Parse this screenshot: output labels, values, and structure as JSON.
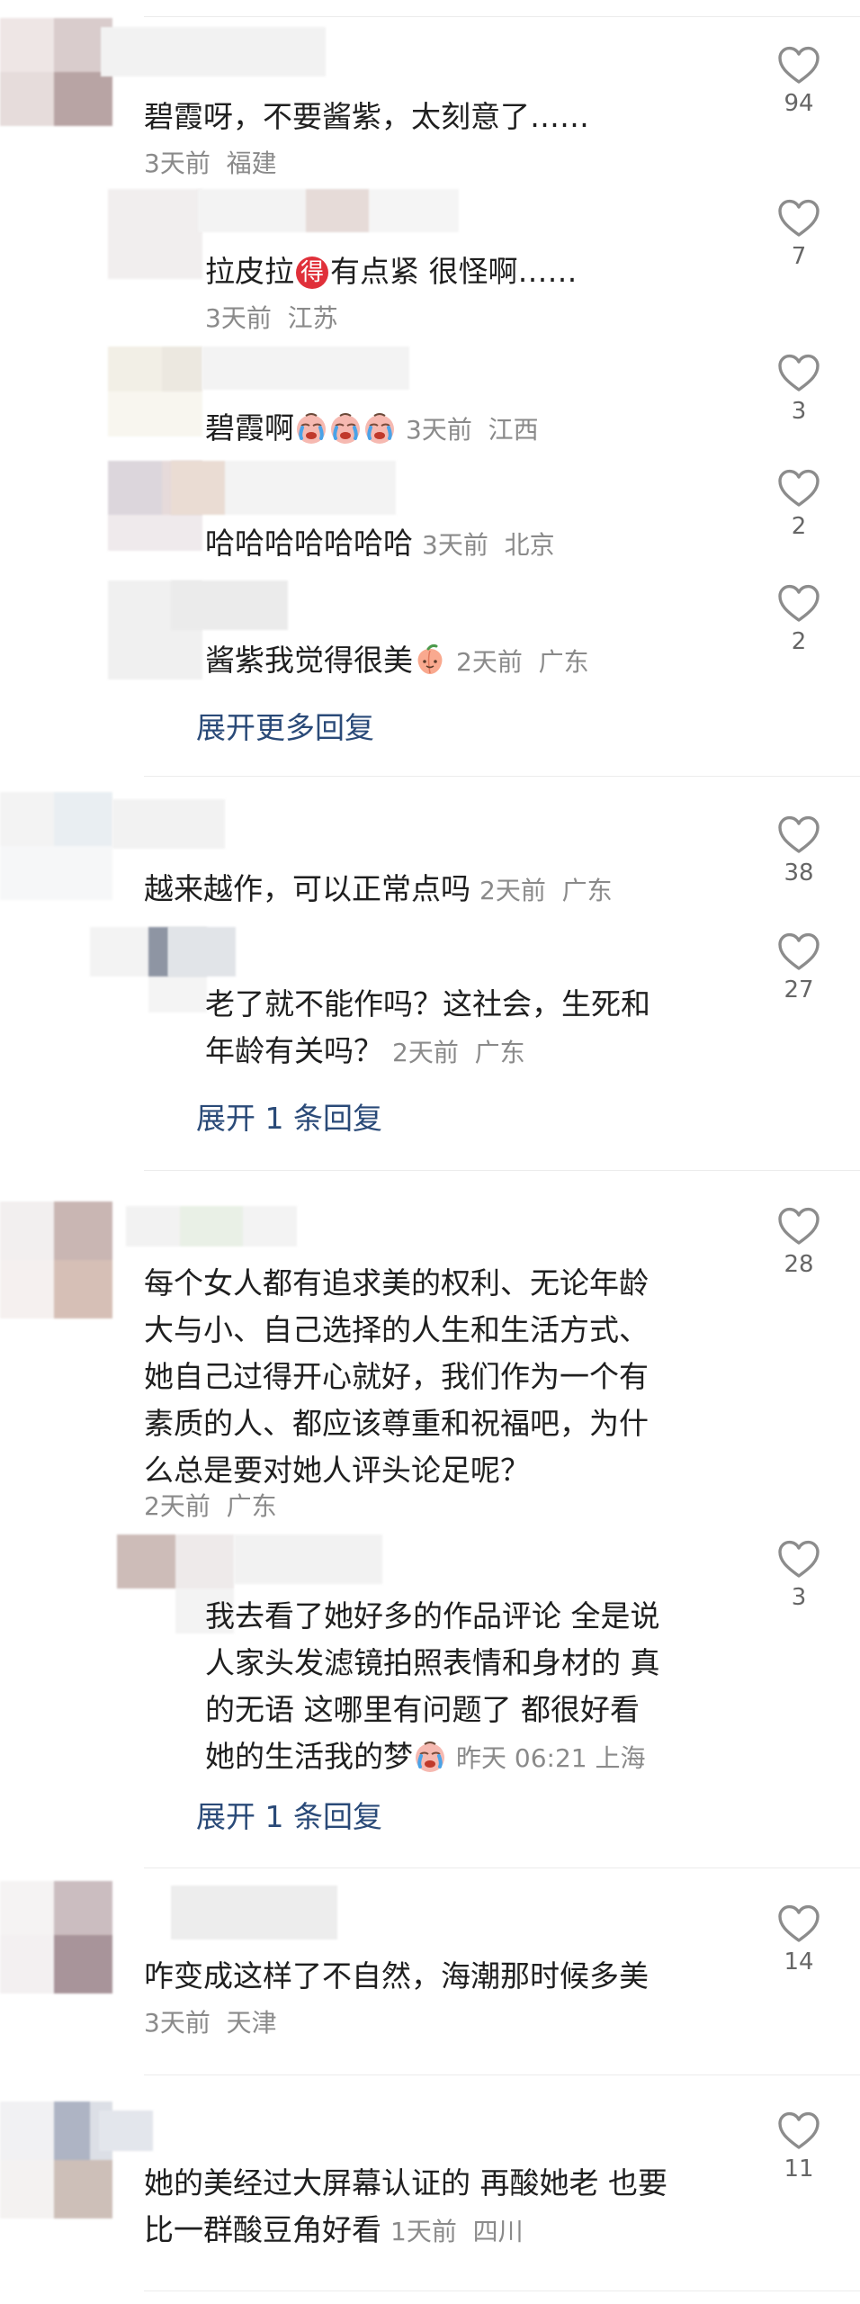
{
  "comments": [
    {
      "text": "碧霞呀，不要酱紫，太刻意了……",
      "meta": "3天前  福建",
      "likes": "94",
      "replies": [
        {
          "text_a": "拉皮拉",
          "badge": "得",
          "text_b": "有点紧 很怪啊……",
          "meta": "3天前  江苏",
          "likes": "7"
        },
        {
          "text": "碧霞啊",
          "meta": "3天前  江西",
          "likes": "3"
        },
        {
          "text": "哈哈哈哈哈哈哈",
          "meta": "3天前  北京",
          "likes": "2"
        },
        {
          "text": "酱紫我觉得很美",
          "meta": "2天前  广东",
          "likes": "2"
        }
      ],
      "expand": "展开更多回复"
    },
    {
      "text": "越来越作，可以正常点吗",
      "meta": "2天前  广东",
      "likes": "38",
      "replies": [
        {
          "line1": "老了就不能作吗？这社会，生死和",
          "line2": "年龄有关吗？",
          "meta": "2天前  广东",
          "likes": "27"
        }
      ],
      "expand": "展开 1 条回复"
    },
    {
      "lines": [
        "每个女人都有追求美的权利、无论年龄",
        "大与小、自己选择的人生和生活方式、",
        "她自己过得开心就好，我们作为一个有",
        "素质的人、都应该尊重和祝福吧，为什",
        "么总是要对她人评头论足呢？"
      ],
      "meta": "2天前  广东",
      "likes": "28",
      "replies": [
        {
          "lines": [
            "我去看了她好多的作品评论 全是说",
            "人家头发滤镜拍照表情和身材的 真",
            "的无语 这哪里有问题了 都很好看"
          ],
          "last_line": "她的生活我的梦",
          "meta": "昨天 06:21 上海",
          "likes": "3"
        }
      ],
      "expand": "展开 1 条回复"
    },
    {
      "text": "咋变成这样了不自然，海潮那时候多美",
      "meta": "3天前  天津",
      "likes": "14"
    },
    {
      "line1": "她的美经过大屏幕认证的 再酸她老 也要",
      "line2": "比一群酸豆角好看",
      "meta": "1天前  四川",
      "likes": "11"
    }
  ]
}
